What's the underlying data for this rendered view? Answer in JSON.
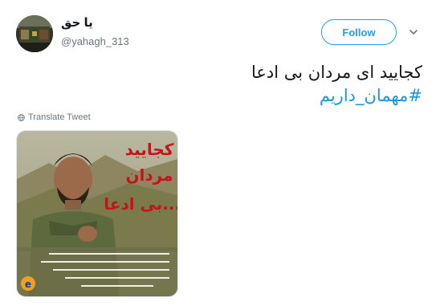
{
  "author": {
    "display_name": "یا حق",
    "handle": "@yahagh_313"
  },
  "follow": {
    "label": "Follow"
  },
  "tweet": {
    "line1": "کجایید ای مردان بی ادعا",
    "hashtag": "#مهمان_داریم"
  },
  "translate": {
    "label": "Translate Tweet"
  },
  "colors": {
    "accent": "#1da1f2",
    "link": "#1b95e0",
    "secondary_text": "#657786",
    "poster_title": "#c8121a"
  }
}
